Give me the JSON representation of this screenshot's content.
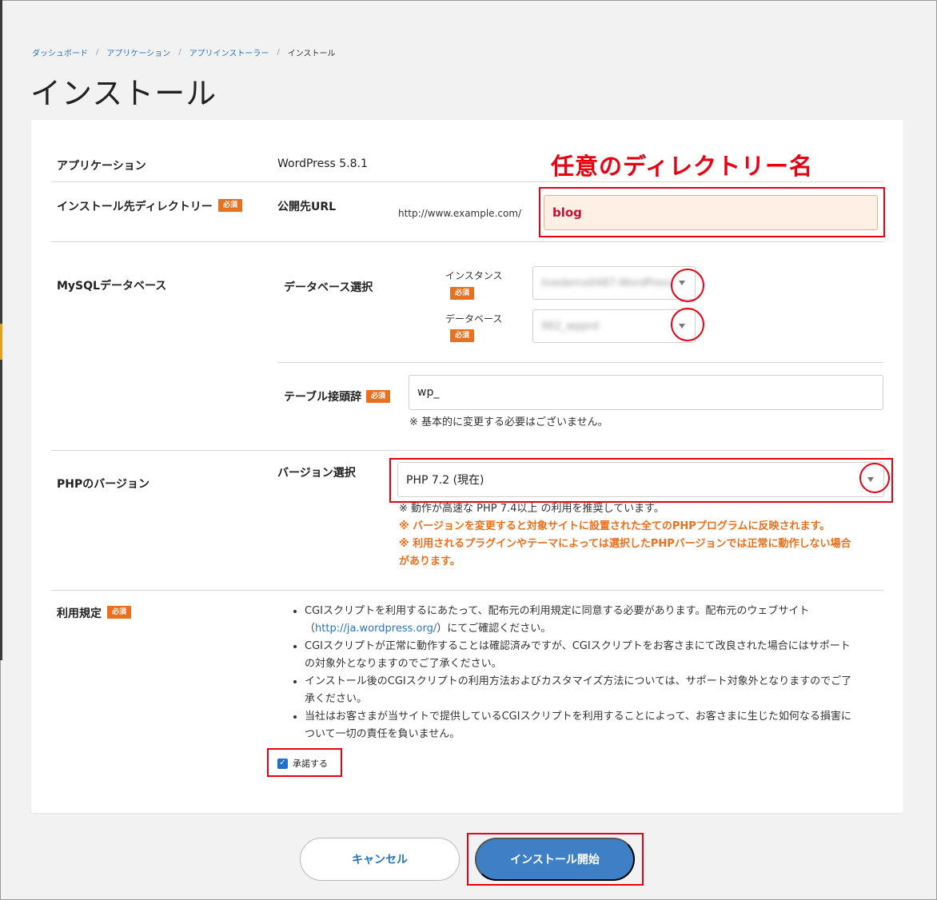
{
  "breadcrumb": {
    "items": [
      "ダッシュボード",
      "アプリケーション",
      "アプリインストーラー"
    ],
    "current": "インストール",
    "separator": "/"
  },
  "page_title": "インストール",
  "annotation": "任意のディレクトリー名",
  "required_badge": "必須",
  "application": {
    "label": "アプリケーション",
    "value": "WordPress 5.8.1"
  },
  "install_dir": {
    "label": "インストール先ディレクトリー",
    "sublabel": "公開先URL",
    "url_prefix": "http://www.example.com/",
    "value": "blog"
  },
  "mysql": {
    "label": "MySQLデータベース",
    "db_select_label": "データベース選択",
    "instance_label": "インスタンス",
    "instance_value": "livedemo0487-WordPress",
    "database_label": "データベース",
    "database_value": "962_wpprd",
    "table_prefix_label": "テーブル接頭辞",
    "table_prefix_value": "wp_",
    "table_prefix_note": "※ 基本的に変更する必要はございません。"
  },
  "php": {
    "label": "PHPのバージョン",
    "select_label": "バージョン選択",
    "selected": "PHP 7.2 (現在)",
    "note1": "※ 動作が高速な PHP 7.4以上 の利用を推奨しています。",
    "note2": "※ バージョンを変更すると対象サイトに設置された全てのPHPプログラムに反映されます。",
    "note3a": "※ 利用されるプラグインやテーマによっては選択したPHPバージョンでは正常に動作しない場合",
    "note3b": "があります。"
  },
  "terms": {
    "label": "利用規定",
    "item1a": "CGIスクリプトを利用するにあたって、配布元の利用規定に同意する必要があります。配布元のウェブサイト",
    "item1b_pre": "（",
    "item1b_link": "http://ja.wordpress.org/",
    "item1b_post": "）にてご確認ください。",
    "item2a": "CGIスクリプトが正常に動作することは確認済みですが、CGIスクリプトをお客さまにて改良された場合にはサポート",
    "item2b": "の対象外となりますのでご了承ください。",
    "item3a": "インストール後のCGIスクリプトの利用方法およびカスタマイズ方法については、サポート対象外となりますのでご了",
    "item3b": "承ください。",
    "item4a": "当社はお客さまが当サイトで提供しているCGIスクリプトを利用することによって、お客さまに生じた如何なる損害に",
    "item4b": "ついて一切の責任を負いません。",
    "accept_label": "承諾する",
    "accepted": true
  },
  "buttons": {
    "cancel": "キャンセル",
    "install": "インストール開始"
  },
  "colors": {
    "annotation_red": "#e60012",
    "badge_orange": "#e8701f",
    "primary_blue": "#3f7fc6",
    "link_blue": "#2b73b8"
  }
}
